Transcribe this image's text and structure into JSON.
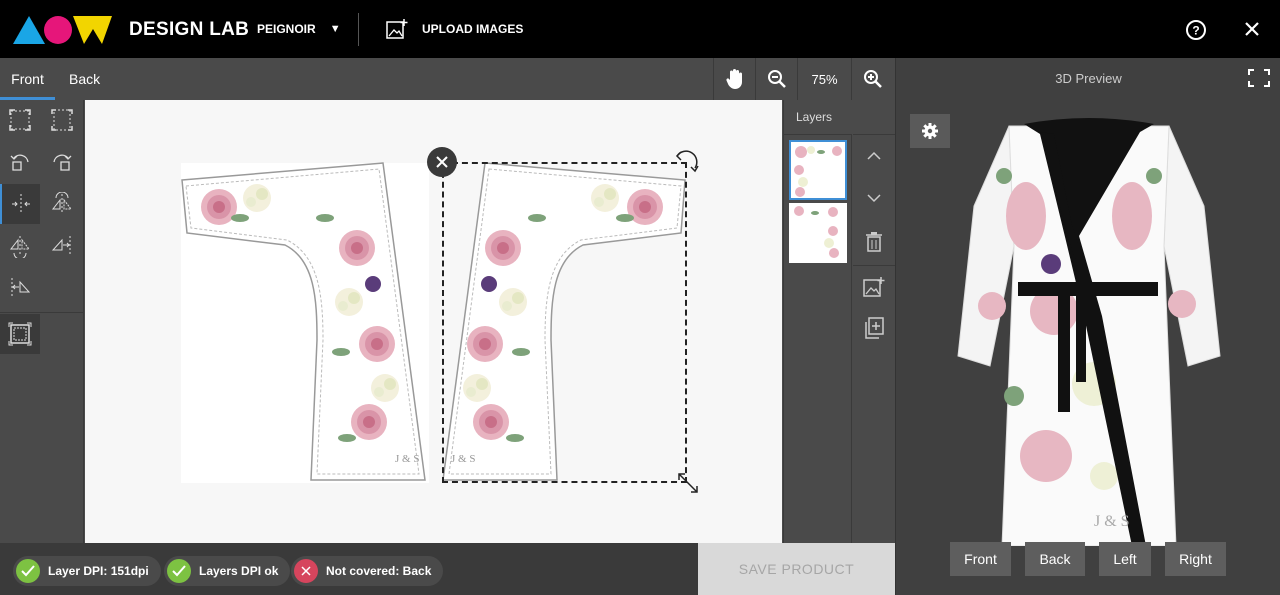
{
  "header": {
    "brand": "DESIGN LAB",
    "product": "PEIGNOIR",
    "upload_label": "UPLOAD IMAGES"
  },
  "tabs": {
    "front": "Front",
    "back": "Back"
  },
  "zoom": {
    "value": "75%"
  },
  "layers": {
    "title": "Layers"
  },
  "status": {
    "layer_dpi": "Layer DPI: 151dpi",
    "layers_dpi": "Layers DPI ok",
    "not_covered": "Not covered: Back"
  },
  "save_label": "SAVE PRODUCT",
  "preview": {
    "title": "3D Preview",
    "views": [
      "Front",
      "Back",
      "Left",
      "Right"
    ]
  },
  "artwork": {
    "monogram": "J & S"
  },
  "colors": {
    "accent": "#3f8fd6",
    "ok": "#7dc242",
    "error": "#d6455d",
    "logo_cyan": "#1aa6e6",
    "logo_magenta": "#e6167a",
    "logo_yellow": "#f2d500"
  }
}
